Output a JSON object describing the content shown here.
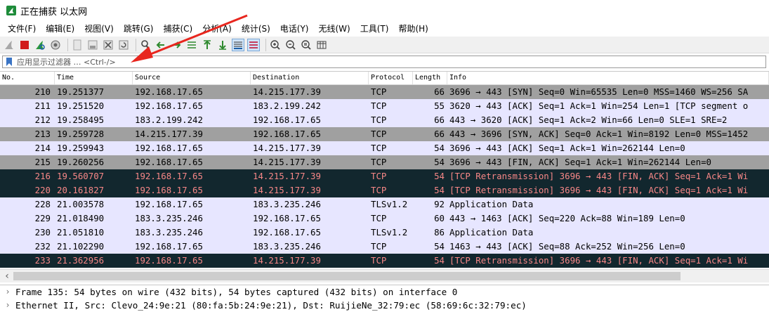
{
  "window": {
    "title": "正在捕获 以太网"
  },
  "menu": [
    "文件(F)",
    "编辑(E)",
    "视图(V)",
    "跳转(G)",
    "捕获(C)",
    "分析(A)",
    "统计(S)",
    "电话(Y)",
    "无线(W)",
    "工具(T)",
    "帮助(H)"
  ],
  "filter": {
    "placeholder": "应用显示过滤器 … <Ctrl-/>"
  },
  "columns": [
    "No.",
    "Time",
    "Source",
    "Destination",
    "Protocol",
    "Length",
    "Info"
  ],
  "rows": [
    {
      "no": "210",
      "time": "19.251377",
      "src": "192.168.17.65",
      "dst": "14.215.177.39",
      "proto": "TCP",
      "len": "66",
      "info": "3696 → 443 [SYN] Seq=0 Win=65535 Len=0 MSS=1460 WS=256 SA",
      "style": "gray"
    },
    {
      "no": "211",
      "time": "19.251520",
      "src": "192.168.17.65",
      "dst": "183.2.199.242",
      "proto": "TCP",
      "len": "55",
      "info": "3620 → 443 [ACK] Seq=1 Ack=1 Win=254 Len=1 [TCP segment o",
      "style": "lav"
    },
    {
      "no": "212",
      "time": "19.258495",
      "src": "183.2.199.242",
      "dst": "192.168.17.65",
      "proto": "TCP",
      "len": "66",
      "info": "443 → 3620 [ACK] Seq=1 Ack=2 Win=66 Len=0 SLE=1 SRE=2",
      "style": "lav"
    },
    {
      "no": "213",
      "time": "19.259728",
      "src": "14.215.177.39",
      "dst": "192.168.17.65",
      "proto": "TCP",
      "len": "66",
      "info": "443 → 3696 [SYN, ACK] Seq=0 Ack=1 Win=8192 Len=0 MSS=1452",
      "style": "gray"
    },
    {
      "no": "214",
      "time": "19.259943",
      "src": "192.168.17.65",
      "dst": "14.215.177.39",
      "proto": "TCP",
      "len": "54",
      "info": "3696 → 443 [ACK] Seq=1 Ack=1 Win=262144 Len=0",
      "style": "lav"
    },
    {
      "no": "215",
      "time": "19.260256",
      "src": "192.168.17.65",
      "dst": "14.215.177.39",
      "proto": "TCP",
      "len": "54",
      "info": "3696 → 443 [FIN, ACK] Seq=1 Ack=1 Win=262144 Len=0",
      "style": "gray"
    },
    {
      "no": "216",
      "time": "19.560707",
      "src": "192.168.17.65",
      "dst": "14.215.177.39",
      "proto": "TCP",
      "len": "54",
      "info": "[TCP Retransmission] 3696 → 443 [FIN, ACK] Seq=1 Ack=1 Wi",
      "style": "dark"
    },
    {
      "no": "220",
      "time": "20.161827",
      "src": "192.168.17.65",
      "dst": "14.215.177.39",
      "proto": "TCP",
      "len": "54",
      "info": "[TCP Retransmission] 3696 → 443 [FIN, ACK] Seq=1 Ack=1 Wi",
      "style": "dark"
    },
    {
      "no": "228",
      "time": "21.003578",
      "src": "192.168.17.65",
      "dst": "183.3.235.246",
      "proto": "TLSv1.2",
      "len": "92",
      "info": "Application Data",
      "style": "lav"
    },
    {
      "no": "229",
      "time": "21.018490",
      "src": "183.3.235.246",
      "dst": "192.168.17.65",
      "proto": "TCP",
      "len": "60",
      "info": "443 → 1463 [ACK] Seq=220 Ack=88 Win=189 Len=0",
      "style": "lav"
    },
    {
      "no": "230",
      "time": "21.051810",
      "src": "183.3.235.246",
      "dst": "192.168.17.65",
      "proto": "TLSv1.2",
      "len": "86",
      "info": "Application Data",
      "style": "lav"
    },
    {
      "no": "232",
      "time": "21.102290",
      "src": "192.168.17.65",
      "dst": "183.3.235.246",
      "proto": "TCP",
      "len": "54",
      "info": "1463 → 443 [ACK] Seq=88 Ack=252 Win=256 Len=0",
      "style": "lav"
    },
    {
      "no": "233",
      "time": "21.362956",
      "src": "192.168.17.65",
      "dst": "14.215.177.39",
      "proto": "TCP",
      "len": "54",
      "info": "[TCP Retransmission] 3696 → 443 [FIN, ACK] Seq=1 Ack=1 Wi",
      "style": "dark"
    }
  ],
  "details": [
    "Frame 135: 54 bytes on wire (432 bits), 54 bytes captured (432 bits) on interface 0",
    "Ethernet II, Src: Clevo_24:9e:21 (80:fa:5b:24:9e:21), Dst: RuijieNe_32:79:ec (58:69:6c:32:79:ec)"
  ],
  "colors": {
    "row_gray": "#a0a0a0",
    "row_lavender": "#e7e6ff",
    "row_dark": "#12272e",
    "row_dark_text": "#f78787",
    "arrow": "#e8261e"
  },
  "icons": [
    "shark-fin-start-icon",
    "stop-square-icon",
    "restart-fin-icon",
    "options-gear-icon",
    "open-file-icon",
    "save-file-icon",
    "close-file-icon",
    "reload-icon",
    "find-packet-icon",
    "go-back-icon",
    "go-forward-icon",
    "go-to-packet-icon",
    "go-first-icon",
    "go-last-icon",
    "autoscroll-icon",
    "colorize-icon",
    "zoom-in-icon",
    "zoom-out-icon",
    "zoom-reset-icon",
    "resize-columns-icon"
  ]
}
